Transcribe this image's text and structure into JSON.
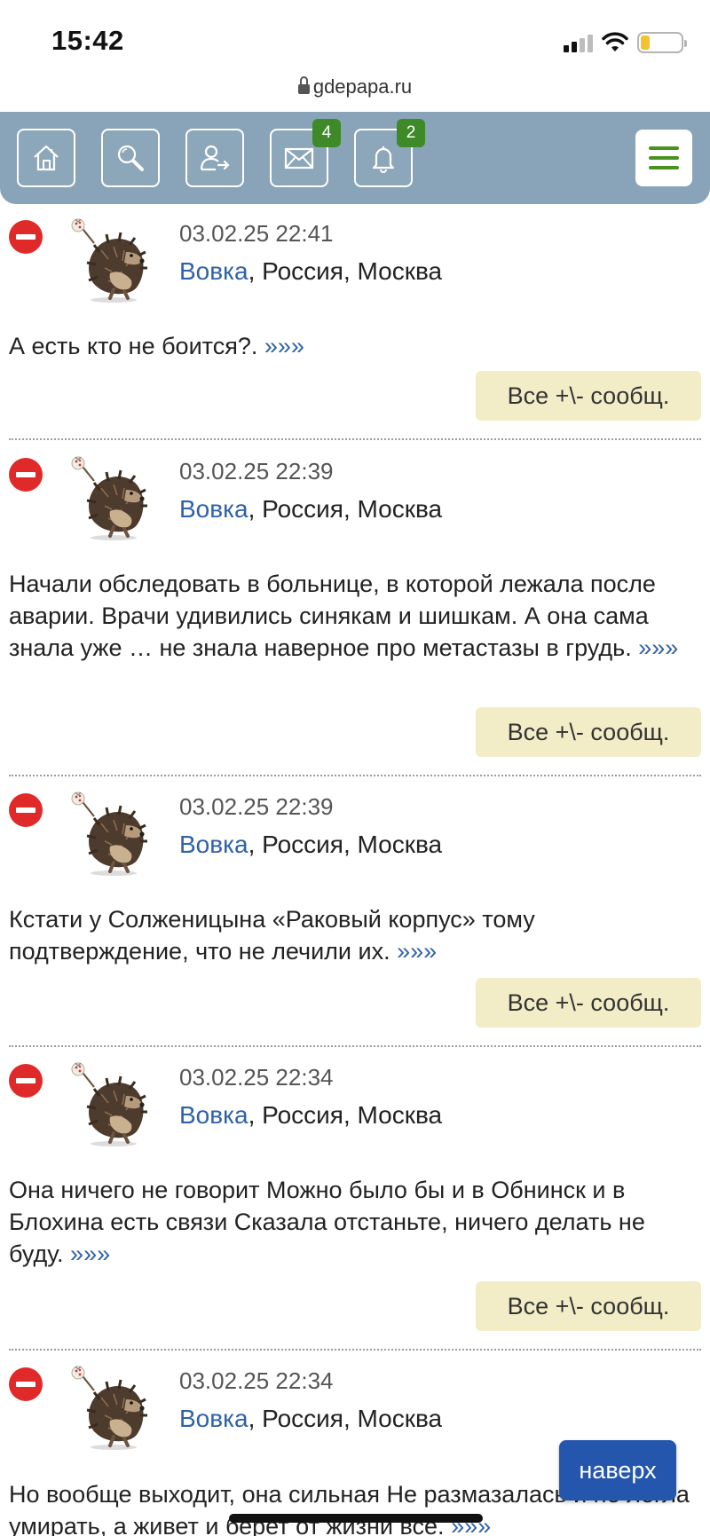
{
  "status_bar": {
    "time": "15:42"
  },
  "browser": {
    "url": "gdepapa.ru"
  },
  "nav": {
    "messages_badge": "4",
    "notifications_badge": "2"
  },
  "posts": [
    {
      "date": "03.02.25 22:41",
      "author": "Вовка",
      "location": ", Россия, Москва",
      "text": "А есть кто не боится?.",
      "more": "»»»",
      "button": "Все +\\- сообщ."
    },
    {
      "date": "03.02.25 22:39",
      "author": "Вовка",
      "location": ", Россия, Москва",
      "text": "Начали обследовать в больнице, в которой лежала после аварии. Врачи удивились синякам и шишкам. А она сама знала уже … не знала наверное про метастазы в грудь.",
      "more": "»»»",
      "button": "Все +\\- сообщ."
    },
    {
      "date": "03.02.25 22:39",
      "author": "Вовка",
      "location": ", Россия, Москва",
      "text": "Кстати у Солженицына «Раковый корпус» тому подтверждение, что не лечили их.",
      "more": "»»»",
      "button": "Все +\\- сообщ."
    },
    {
      "date": "03.02.25 22:34",
      "author": "Вовка",
      "location": ", Россия, Москва",
      "text": "Она ничего не говорит Можно было бы и в Обнинск и в Блохина есть связи Сказала отстаньте, ничего делать не буду.",
      "more": "»»»",
      "button": "Все +\\- сообщ."
    },
    {
      "date": "03.02.25 22:34",
      "author": "Вовка",
      "location": ", Россия, Москва",
      "text": "Но вообще выходит, она сильная Не размазалась и не легла умирать, а живет и берет от жизни всё.",
      "more": "»»»"
    }
  ],
  "scroll_top_label": "наверх"
}
